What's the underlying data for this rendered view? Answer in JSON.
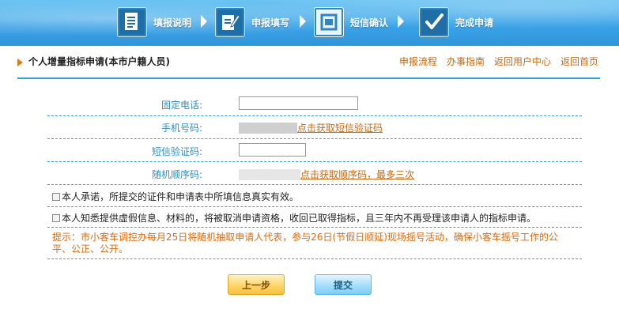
{
  "steps": [
    {
      "label": "填报说明",
      "icon": "document-icon"
    },
    {
      "label": "申报填写",
      "icon": "edit-icon"
    },
    {
      "label": "短信确认",
      "icon": "message-icon"
    },
    {
      "label": "完成申请",
      "icon": "checkmark-icon"
    }
  ],
  "header": {
    "title": "个人增量指标申请(本市户籍人员)",
    "links": [
      "申报流程",
      "办事指南",
      "返回用户中心",
      "返回首页"
    ]
  },
  "form": {
    "landline_label": "固定电话:",
    "landline_value": "",
    "mobile_label": "手机号码:",
    "mobile_link": "点击获取短信验证码",
    "sms_label": "短信验证码:",
    "sms_value": "",
    "random_label": "随机顺序码:",
    "random_link": "点击获取顺序码，最多三次",
    "promise_text": "本人承诺，所提交的证件和申请表中所填信息真实有效。",
    "aware_text": "本人知悉提供虚假信息、材料的，将被取消申请资格，收回已取得指标，且三年内不再受理该申请人的指标申请。",
    "tip_text": "提示：市小客车调控办每月25日将随机抽取申请人代表，参与26日(节假日顺延)现场摇号活动，确保小客车摇号工作的公平、公正、公开。"
  },
  "buttons": {
    "prev": "上一步",
    "submit": "提交"
  },
  "colors": {
    "banner": "#3aa3e6",
    "label": "#2f8fbf",
    "link": "#c86a11",
    "tip": "#d96b10",
    "divider": "#3aa0d8"
  }
}
